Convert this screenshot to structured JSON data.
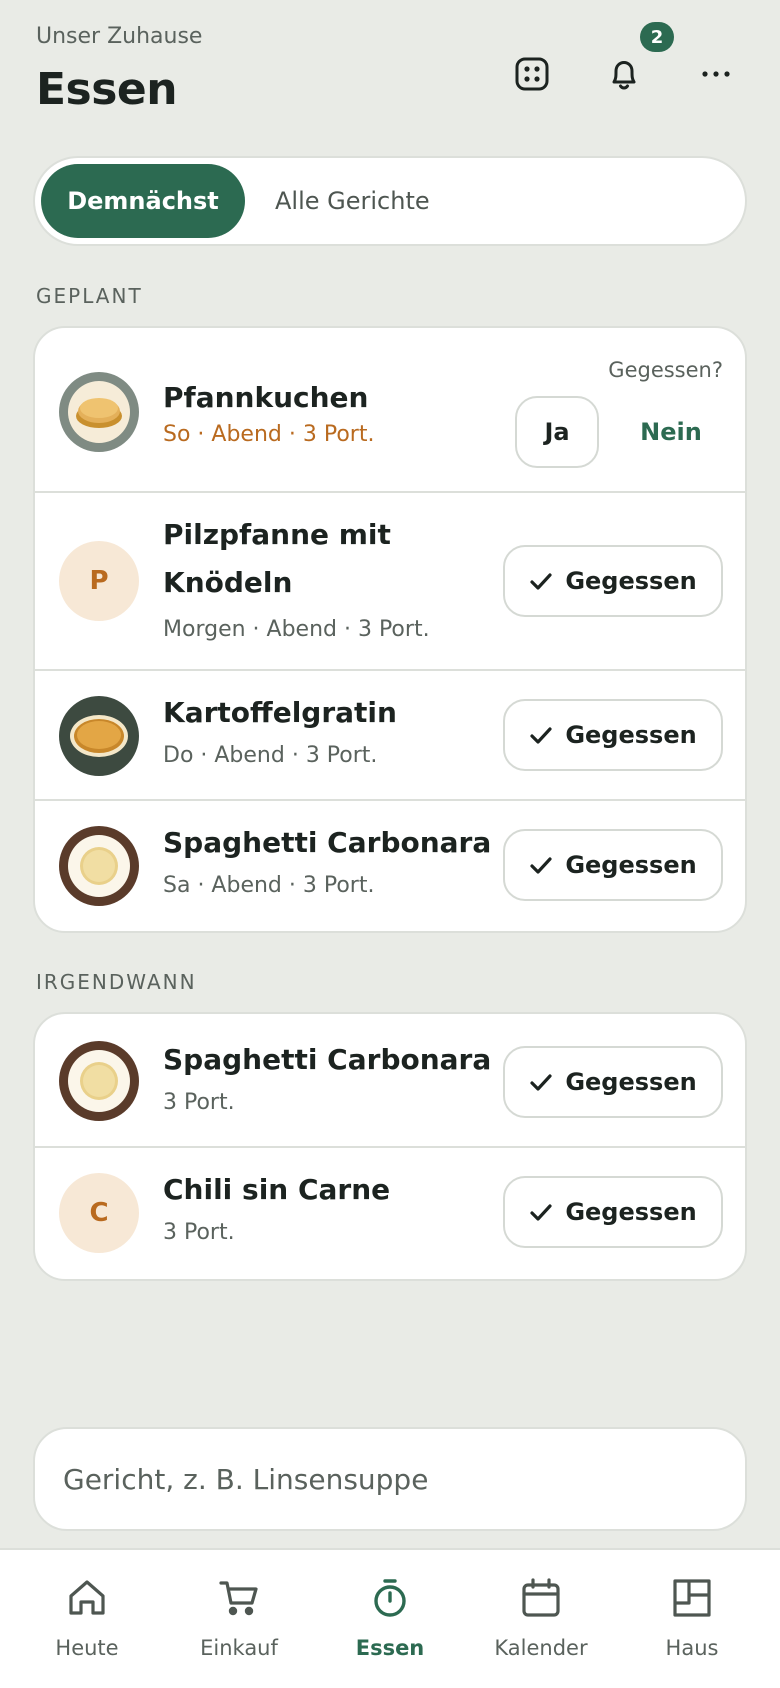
{
  "header": {
    "household": "Unser Zuhause",
    "title": "Essen",
    "notification_count": "2",
    "icons": [
      "grid-icon",
      "bell-icon",
      "more-icon"
    ]
  },
  "tabs": {
    "active": "Demnächst",
    "inactive": "Alle Gerichte"
  },
  "planned": {
    "label": "GEPLANT",
    "first": {
      "name": "Pfannkuchen",
      "meta": "So · Abend · 3 Port.",
      "question": "Gegessen?",
      "yes": "Ja",
      "no": "Nein"
    },
    "items": [
      {
        "name": "Pilzpfanne mit Knödeln",
        "meta": "Morgen · Abend · 3 Port.",
        "avatar_letter": "P",
        "button": "Gegessen"
      },
      {
        "name": "Kartoffelgratin",
        "meta": "Do · Abend · 3 Port.",
        "button": "Gegessen"
      },
      {
        "name": "Spaghetti Carbonara",
        "meta": "Sa · Abend · 3 Port.",
        "button": "Gegessen"
      }
    ]
  },
  "anytime": {
    "label": "IRGENDWANN",
    "items": [
      {
        "name": "Spaghetti Carbonara",
        "meta": "3 Port.",
        "button": "Gegessen"
      },
      {
        "name": "Chili sin Carne",
        "meta": "3 Port.",
        "avatar_letter": "C",
        "button": "Gegessen"
      }
    ]
  },
  "add_meal": {
    "placeholder": "Gericht, z. B. Linsensuppe"
  },
  "nav": {
    "items": [
      {
        "label": "Heute",
        "icon": "home-icon"
      },
      {
        "label": "Einkauf",
        "icon": "cart-icon"
      },
      {
        "label": "Essen",
        "icon": "timer-icon",
        "active": true
      },
      {
        "label": "Kalender",
        "icon": "calendar-icon"
      },
      {
        "label": "Haus",
        "icon": "layout-icon"
      }
    ]
  },
  "colors": {
    "background": "#e9ebe6",
    "accent": "#2c6a51",
    "warm": "#b96a1f",
    "card": "#ffffff"
  }
}
